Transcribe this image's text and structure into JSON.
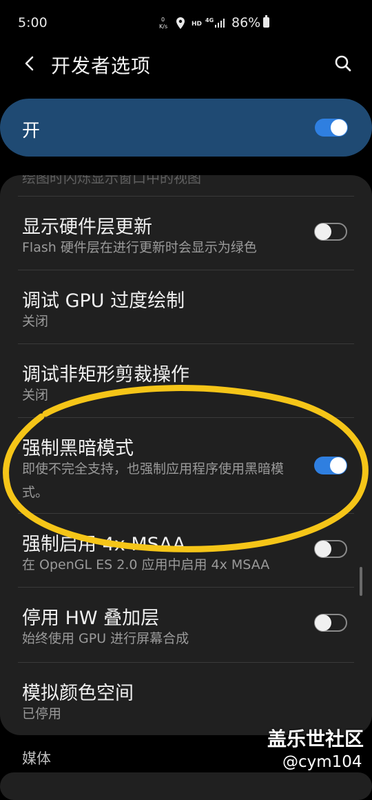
{
  "status_bar": {
    "time": "5:00",
    "speed": "0\nK/s",
    "hd": "HD",
    "net": "4G",
    "battery": "86%"
  },
  "app_bar": {
    "title": "开发者选项"
  },
  "master": {
    "label": "开",
    "enabled": true
  },
  "card": {
    "clipped_text": "绘图时闪烁显示窗口中的视图",
    "items": [
      {
        "title": "显示硬件层更新",
        "summary": "Flash 硬件层在进行更新时会显示为绿色",
        "toggle": false
      },
      {
        "title": "调试 GPU 过度绘制",
        "summary": "关闭"
      },
      {
        "title": "调试非矩形剪裁操作",
        "summary": "关闭"
      },
      {
        "title": "强制黑暗模式",
        "summary": "即使不完全支持，也强制应用程序使用黑暗模式。",
        "toggle": true
      },
      {
        "title": "强制启用 4x MSAA",
        "summary": "在 OpenGL ES 2.0 应用中启用 4x MSAA",
        "toggle": false
      },
      {
        "title": "停用 HW 叠加层",
        "summary": "始终使用 GPU 进行屏幕合成",
        "toggle": false
      },
      {
        "title": "模拟颜色空间",
        "summary": "已停用"
      }
    ]
  },
  "section_header": "媒体",
  "watermark": {
    "line1": "盖乐世社区",
    "line2": "@cym104"
  },
  "colors": {
    "accent": "#2f7fe0",
    "master_bg": "#1f4a73",
    "card_bg": "#202020",
    "annotation": "#f5c518"
  }
}
